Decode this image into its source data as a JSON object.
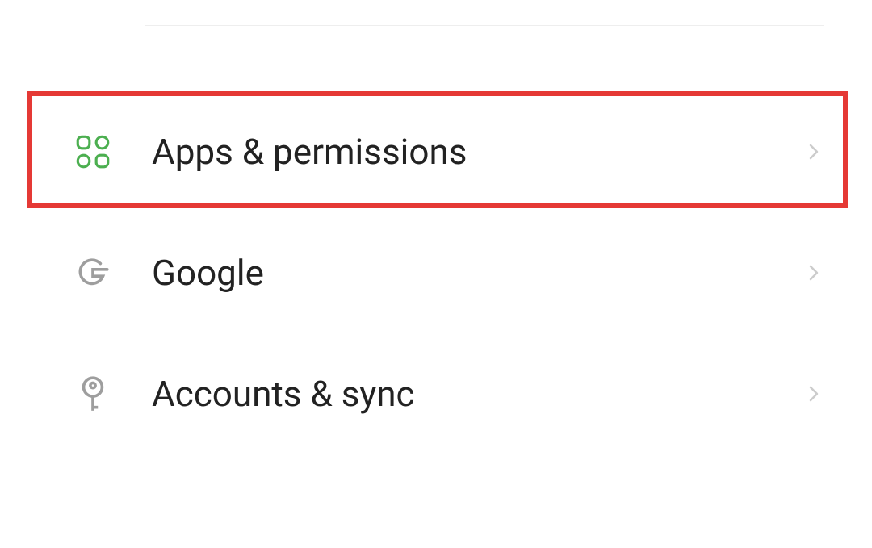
{
  "settings": {
    "items": [
      {
        "label": "Apps & permissions",
        "icon": "apps-icon",
        "icon_color": "#4CAF50",
        "highlighted": true
      },
      {
        "label": "Google",
        "icon": "google-icon",
        "icon_color": "#9E9E9E",
        "highlighted": false
      },
      {
        "label": "Accounts & sync",
        "icon": "key-icon",
        "icon_color": "#9E9E9E",
        "highlighted": false
      }
    ]
  },
  "colors": {
    "highlight_border": "#e53935",
    "chevron": "#cccccc",
    "text": "#222222"
  }
}
